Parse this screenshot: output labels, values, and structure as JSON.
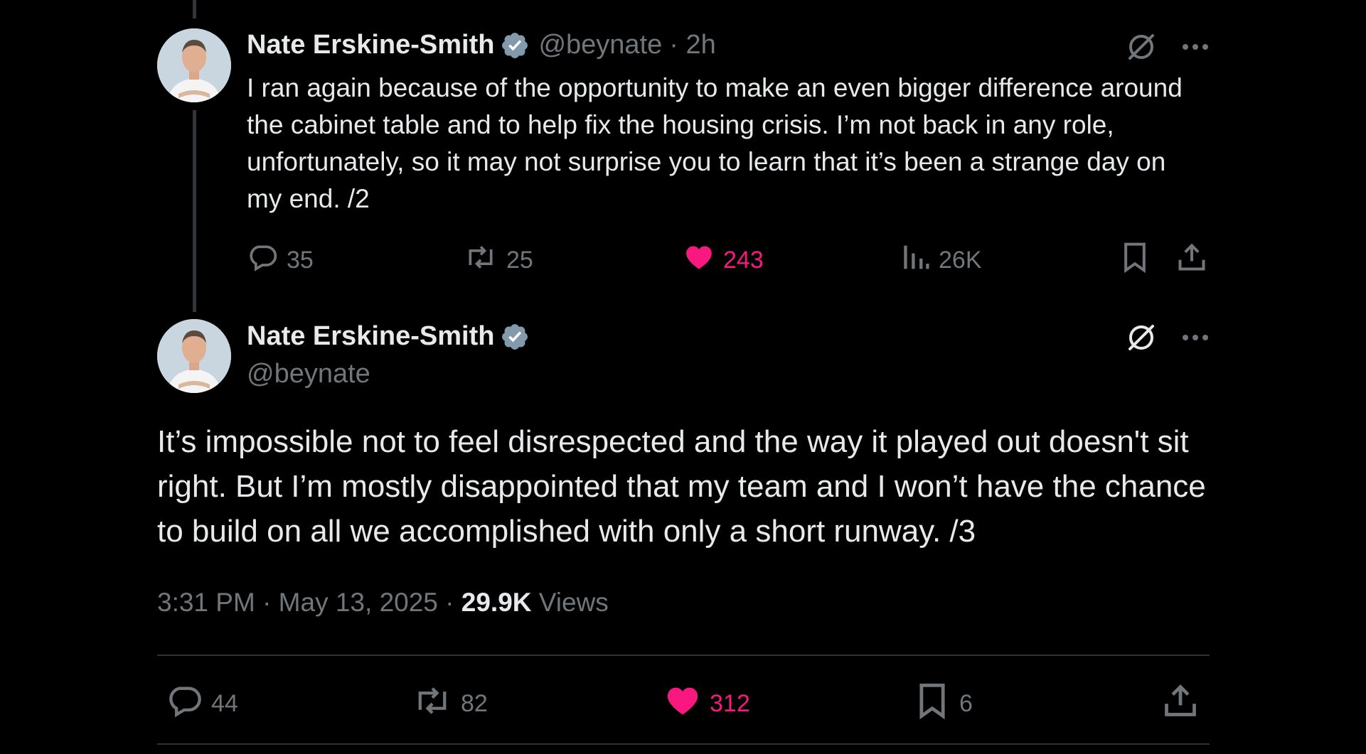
{
  "tweet1": {
    "author_name": "Nate Erskine-Smith",
    "handle": "@beynate",
    "time": "· 2h",
    "text": "I ran again because of the opportunity to make an even bigger difference around the cabinet table and to help fix the housing crisis. I’m not back in any role, unfortunately, so it may not surprise you to learn that it’s been a strange day on my end. /2",
    "replies": "35",
    "reposts": "25",
    "likes": "243",
    "views": "26K"
  },
  "tweet2": {
    "author_name": "Nate Erskine-Smith",
    "handle": "@beynate",
    "text": "It’s impossible not to feel disrespected and the way it played out doesn't sit right. But I’m mostly disappointed that my team and I won’t have the chance to build on all we accomplished with only a short runway. /3",
    "timestamp": "3:31 PM · May 13, 2025 · ",
    "views_count": "29.9K",
    "views_label": " Views",
    "replies": "44",
    "reposts": "82",
    "likes": "312",
    "bookmarks": "6"
  },
  "colors": {
    "background": "#000000",
    "text": "#e7e9ea",
    "muted": "#71767b",
    "like": "#f91880",
    "verified": "#829aab"
  }
}
